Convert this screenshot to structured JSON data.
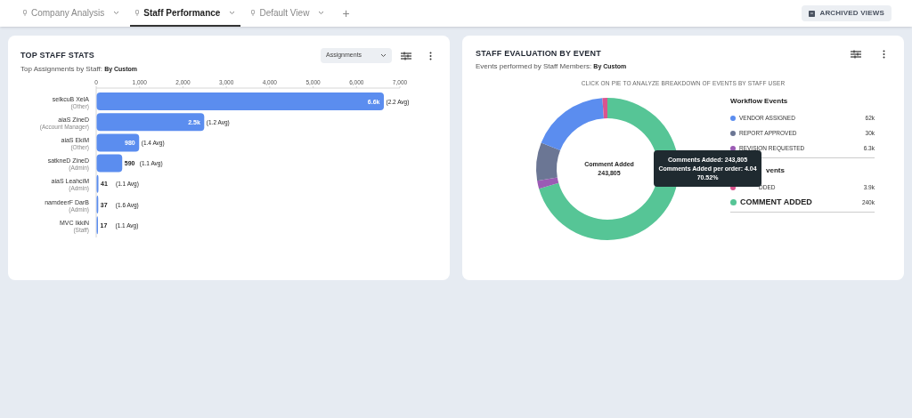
{
  "tabs": [
    {
      "label": "Company Analysis",
      "selected": false
    },
    {
      "label": "Staff Performance",
      "selected": true
    },
    {
      "label": "Default View",
      "selected": false
    }
  ],
  "add_tab": "+",
  "archived_button": "ARCHIVED VIEWS",
  "top_staff": {
    "title": "TOP STAFF STATS",
    "subtitle": "Top Assignments by Staff:",
    "subtitle_value": "By Custom",
    "dropdown": "Assignments",
    "chart_data": {
      "type": "bar",
      "orientation": "horizontal",
      "categories": [
        "selkcuB XelA",
        "aiaS ZineD",
        "aiaS EkiM",
        "satkneD ZineD",
        "aiaS LeahciM",
        "namdeerF DarB",
        "MVC IkkiN"
      ],
      "values": [
        6620,
        2480,
        980,
        590,
        41,
        37,
        17
      ],
      "xlim": [
        0,
        7000
      ],
      "xticks": [
        {
          "value": 0,
          "label": "0"
        },
        {
          "value": 1000,
          "label": "1,000"
        },
        {
          "value": 2000,
          "label": "2,000"
        },
        {
          "value": 3000,
          "label": "3,000"
        },
        {
          "value": 4000,
          "label": "4,000"
        },
        {
          "value": 5000,
          "label": "5,000"
        },
        {
          "value": 6000,
          "label": "6,000"
        },
        {
          "value": 7000,
          "label": "7,000"
        }
      ],
      "value_labels": [
        "6.6k",
        "2.5k",
        "980",
        "590",
        "41",
        "37",
        "17"
      ]
    },
    "rows": [
      {
        "role": "(Other)",
        "avg": "(2.2 Avg)"
      },
      {
        "role": "(Account Manager)",
        "avg": "(1.2 Avg)"
      },
      {
        "role": "(Other)",
        "avg": "(1.4 Avg)"
      },
      {
        "role": "(Admin)",
        "avg": "(1.1 Avg)"
      },
      {
        "role": "(Admin)",
        "avg": "(1.1 Avg)"
      },
      {
        "role": "(Admin)",
        "avg": "(1.6 Avg)"
      },
      {
        "role": "(Staff)",
        "avg": "(1.1 Avg)"
      }
    ]
  },
  "evaluation": {
    "title": "STAFF EVALUATION BY EVENT",
    "subtitle": "Events performed by Staff Members:",
    "subtitle_value": "By Custom",
    "hint": "CLICK ON PIE TO ANALYZE BREAKDOWN OF EVENTS BY STAFF USER",
    "chart_data": {
      "type": "donut",
      "values": [
        70.52,
        1.82,
        8.68,
        17.85,
        1.13
      ],
      "colors": [
        "#56c596",
        "#9b5bb4",
        "#6b7694",
        "#5b8def",
        "#d9548f"
      ]
    },
    "center_label": "Comment Added",
    "center_value": "243,805",
    "legend_groups": [
      {
        "title": "Workflow Events",
        "items": [
          {
            "label": "VENDOR ASSIGNED",
            "value": "62k",
            "color": "#5b8def",
            "selected": false
          },
          {
            "label": "REPORT APPROVED",
            "value": "30k",
            "color": "#6b7694",
            "selected": false
          },
          {
            "label": "REVISION REQUESTED",
            "value": "6.3k",
            "color": "#9b5bb4",
            "selected": false
          }
        ]
      },
      {
        "title": "vents",
        "kind": "clipped",
        "items": [
          {
            "label": "DDED",
            "kind": "clipped",
            "value": "3.9k",
            "color": "#d9548f",
            "selected": false
          },
          {
            "label": "COMMENT ADDED",
            "value": "240k",
            "color": "#56c596",
            "selected": true
          }
        ]
      }
    ],
    "tooltip": [
      "Comments Added: 243,805",
      "Comments Added per order: 4.04",
      "70.52%"
    ]
  }
}
